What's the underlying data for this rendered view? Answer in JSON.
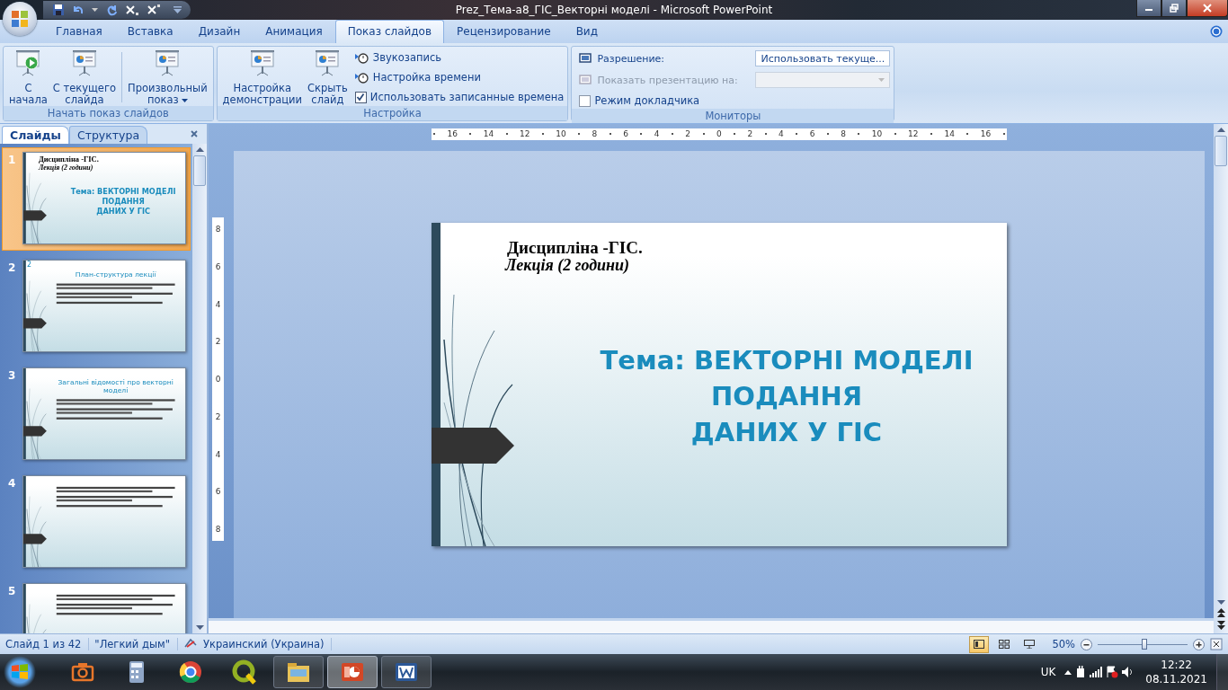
{
  "window": {
    "title": "Prez_Тема-а8_ГІС_Векторні моделі - Microsoft PowerPoint"
  },
  "tabs": [
    {
      "label": "Главная",
      "selected": false
    },
    {
      "label": "Вставка",
      "selected": false
    },
    {
      "label": "Дизайн",
      "selected": false
    },
    {
      "label": "Анимация",
      "selected": false
    },
    {
      "label": "Показ слайдов",
      "selected": true
    },
    {
      "label": "Рецензирование",
      "selected": false
    },
    {
      "label": "Вид",
      "selected": false
    }
  ],
  "ribbon_groups": [
    {
      "label": "Начать показ слайдов",
      "items": [
        {
          "kind": "large",
          "lines": [
            "С",
            "начала"
          ]
        },
        {
          "kind": "large",
          "lines": [
            "С текущего",
            "слайда"
          ]
        },
        {
          "kind": "separator"
        },
        {
          "kind": "large",
          "lines": [
            "Произвольный",
            "показ"
          ],
          "has_menu": true
        }
      ]
    },
    {
      "label": "Настройка",
      "items": [
        {
          "kind": "large",
          "lines": [
            "Настройка",
            "демонстрации"
          ]
        },
        {
          "kind": "large",
          "lines": [
            "Скрыть",
            "слайд"
          ]
        },
        {
          "kind": "small",
          "label": "Звукозапись"
        },
        {
          "kind": "small",
          "label": "Настройка времени"
        },
        {
          "kind": "checkbox",
          "label": "Использовать записанные времена",
          "checked": true
        }
      ]
    },
    {
      "label": "Мониторы",
      "items": [
        {
          "kind": "dropdown",
          "label": "Разрешение:",
          "value": "Использовать текуще...",
          "disabled": false
        },
        {
          "kind": "dropdown",
          "label": "Показать презентацию на:",
          "disabled": true
        },
        {
          "kind": "checkbox",
          "label": "Режим докладчика",
          "checked": false
        }
      ]
    }
  ],
  "pane_tabs": [
    {
      "label": "Слайды",
      "selected": true
    },
    {
      "label": "Структура",
      "selected": false
    }
  ],
  "slides": [
    {
      "number": "1",
      "selected": true,
      "kind": "title",
      "heading": "Дисципліна -ГІС.",
      "subheading": "Лекція (2 години)",
      "title_lines": [
        "Тема: ВЕКТОРНІ МОДЕЛІ",
        "ПОДАННЯ",
        "ДАНИХ У ГІС"
      ]
    },
    {
      "number": "2",
      "selected": false,
      "kind": "content",
      "corner_label": "2",
      "title": "План-структура лекції"
    },
    {
      "number": "3",
      "selected": false,
      "kind": "content",
      "title": "Загальні відомості про векторні моделі"
    },
    {
      "number": "4",
      "selected": false,
      "kind": "content"
    },
    {
      "number": "5",
      "selected": false,
      "kind": "content"
    }
  ],
  "horizontal_ruler": [
    "16",
    "14",
    "12",
    "10",
    "8",
    "6",
    "4",
    "2",
    "0",
    "2",
    "4",
    "6",
    "8",
    "10",
    "12",
    "14",
    "16"
  ],
  "vertical_ruler": [
    "8",
    "6",
    "4",
    "2",
    "0",
    "2",
    "4",
    "6",
    "8"
  ],
  "current_slide": {
    "heading": "Дисципліна -ГІС.",
    "subheading": "Лекція (2 години)",
    "title_lines": [
      "Тема: ВЕКТОРНІ МОДЕЛІ",
      "ПОДАННЯ",
      "ДАНИХ У ГІС"
    ]
  },
  "status_bar": {
    "slide": "Слайд 1 из 42",
    "theme": "\"Легкий дым\"",
    "language": "Украинский (Украина)",
    "views": [
      {
        "selected": true
      },
      {
        "selected": false
      },
      {
        "selected": false
      }
    ],
    "zoom": "50%",
    "zoom_slider": {
      "level": 0.52
    }
  },
  "taskbar": {
    "apps": [
      {
        "running": false,
        "selected": false
      },
      {
        "running": false,
        "selected": false
      },
      {
        "running": false,
        "selected": false
      },
      {
        "running": false,
        "selected": false
      },
      {
        "running": true,
        "selected": false
      },
      {
        "running": true,
        "selected": true
      },
      {
        "running": true,
        "selected": false
      }
    ],
    "language": "UK",
    "time": "12:22",
    "date": "08.11.2021"
  }
}
